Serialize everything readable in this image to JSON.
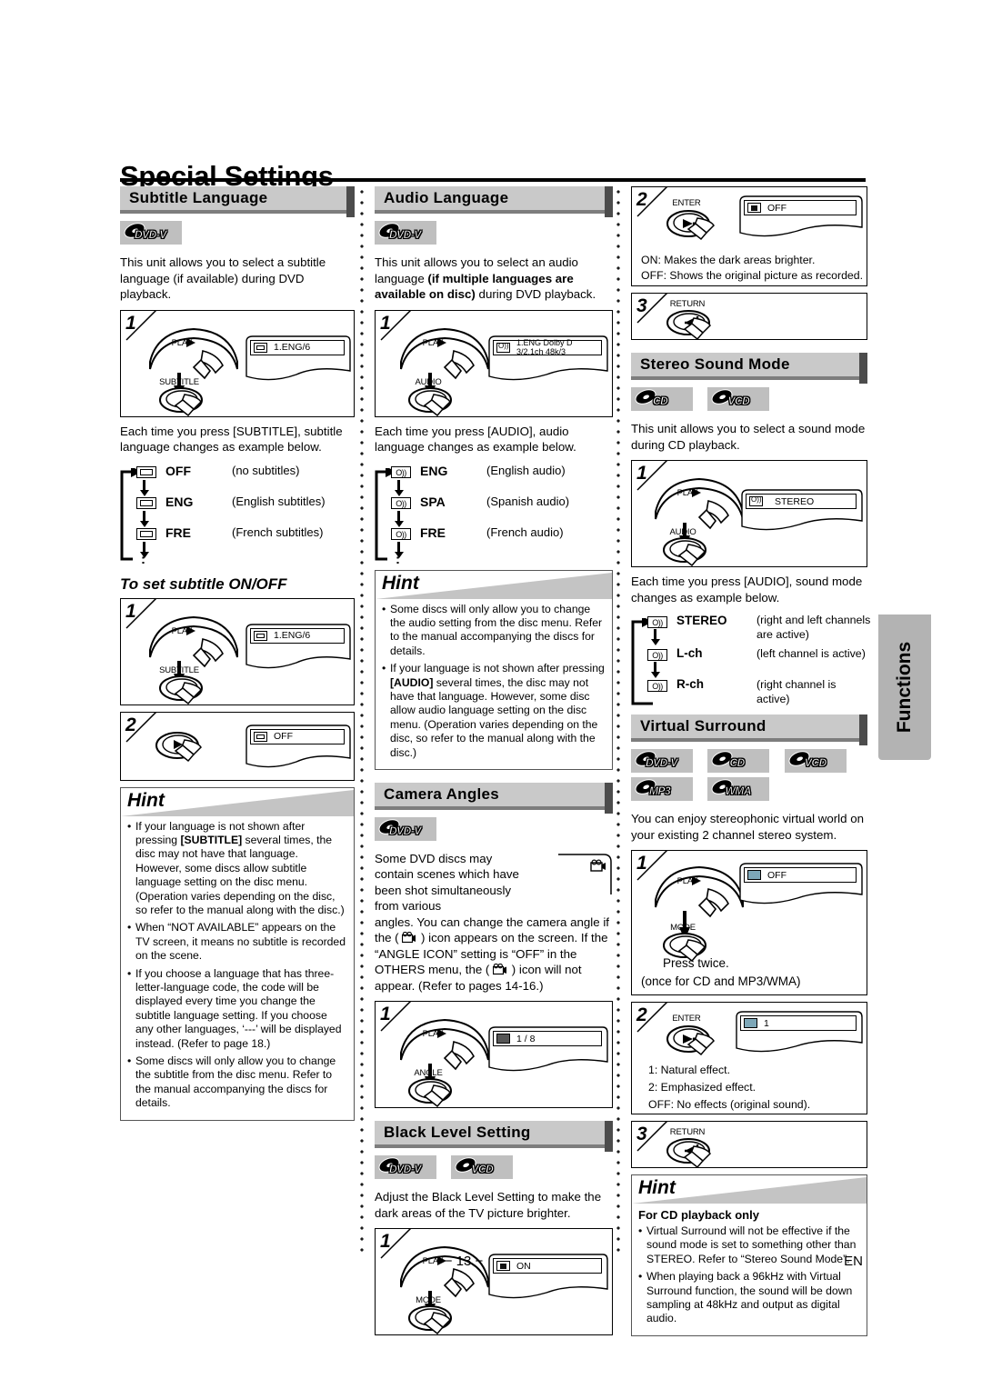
{
  "document": {
    "title": "Special Settings",
    "page_number": "− 13 −",
    "language_code": "EN",
    "side_tab": "Functions"
  },
  "column_left": {
    "subtitle_language": {
      "heading": "Subtitle Language",
      "badges": [
        "DVD-V"
      ],
      "intro": "This unit allows you to select a subtitle language (if available) during DVD playback.",
      "step1": {
        "number": "1",
        "btn_top": "PLAY",
        "btn_bottom": "SUBTITLE",
        "osd_value": "1.ENG/6"
      },
      "after_steps": "Each time you press [SUBTITLE], subtitle language changes as example below.",
      "sequence": [
        {
          "code": "OFF",
          "desc": "(no subtitles)"
        },
        {
          "code": "ENG",
          "desc": "(English subtitles)"
        },
        {
          "code": "FRE",
          "desc": "(French subtitles)"
        }
      ]
    },
    "on_off": {
      "heading": "To set subtitle ON/OFF",
      "step1": {
        "number": "1",
        "btn_top": "PLAY",
        "btn_bottom": "SUBTITLE",
        "osd_value": "1.ENG/6"
      },
      "step2": {
        "number": "2",
        "osd_value": "OFF"
      }
    },
    "hint": {
      "heading": "Hint",
      "items": [
        "If your language is not shown after pressing [SUBTITLE] several times, the disc may not have that language. However, some discs allow subtitle language setting on the disc menu. (Operation varies depending on the disc, so refer to the manual along with the disc.)",
        "When “NOT AVAILABLE” appears on the TV screen, it means no subtitle is recorded on the scene.",
        "If you choose a language that has three-letter-language code, the code will be displayed every time you change the subtitle language setting. If you choose any other languages, ‘---’ will be displayed instead. (Refer to page 18.)",
        "Some discs will only allow you to change the subtitle from the disc menu. Refer to the manual accompanying the discs for details."
      ]
    }
  },
  "column_middle": {
    "audio_language": {
      "heading": "Audio Language",
      "badges": [
        "DVD-V"
      ],
      "intro_a": "This unit allows you to select an audio language ",
      "intro_b": "(if multiple languages are available on disc)",
      "intro_c": " during DVD playback.",
      "step1": {
        "number": "1",
        "btn_top": "PLAY",
        "btn_bottom": "AUDIO",
        "osd_value": "1.ENG  Dolby D  3/2.1ch  48k/3"
      },
      "after_steps": "Each time you press [AUDIO], audio language changes as example below.",
      "sequence": [
        {
          "code": "ENG",
          "desc": "(English audio)"
        },
        {
          "code": "SPA",
          "desc": "(Spanish audio)"
        },
        {
          "code": "FRE",
          "desc": "(French audio)"
        }
      ]
    },
    "hint": {
      "heading": "Hint",
      "items": [
        "Some discs will only allow you to change the audio setting from the disc menu. Refer to the manual accompanying the discs for details.",
        "If your language is not shown after pressing [AUDIO] several times, the disc may not have that language. However, some disc allow audio language setting on the disc menu. (Operation varies depending on the disc, so refer to the manual along with the disc.)"
      ]
    },
    "camera_angles": {
      "heading": "Camera Angles",
      "badges": [
        "DVD-V"
      ],
      "intro": "Some DVD discs may contain scenes which have been shot simultaneously from various angles. You can change the camera angle if the (    ) icon appears on the screen. If the “ANGLE ICON” setting is “OFF” in the OTHERS menu, the (    ) icon will not appear. (Refer to pages 14-16.)",
      "step1": {
        "number": "1",
        "btn_top": "PLAY",
        "btn_bottom": "ANGLE",
        "osd_value": "1 / 8"
      }
    },
    "black_level": {
      "heading": "Black Level Setting",
      "badges": [
        "DVD-V",
        "VCD"
      ],
      "intro": "Adjust the Black Level Setting to make the dark areas of the TV picture brighter.",
      "step1": {
        "number": "1",
        "btn_top": "PLAY",
        "btn_bottom": "MODE",
        "osd_value": "ON"
      }
    }
  },
  "column_right": {
    "black_level_cont": {
      "step2": {
        "number": "2",
        "btn": "ENTER",
        "osd_value": "OFF",
        "note1": "ON: Makes the dark areas brighter.",
        "note2": "OFF: Shows the original picture as recorded."
      },
      "step3": {
        "number": "3",
        "btn": "RETURN"
      }
    },
    "stereo_sound_mode": {
      "heading": "Stereo Sound Mode",
      "badges": [
        "CD",
        "VCD"
      ],
      "intro": "This unit allows you to select a sound mode during CD playback.",
      "step1": {
        "number": "1",
        "btn_top": "PLAY",
        "btn_bottom": "AUDIO",
        "osd_value": "STEREO"
      },
      "after_steps": "Each time you press [AUDIO], sound mode changes as example below.",
      "sequence": [
        {
          "code": "STEREO",
          "desc": "(right and left channels are active)"
        },
        {
          "code": "L-ch",
          "desc": "(left channel is active)"
        },
        {
          "code": "R-ch",
          "desc": "(right channel is active)"
        }
      ]
    },
    "virtual_surround": {
      "heading": "Virtual Surround",
      "badges": [
        "DVD-V",
        "CD",
        "VCD",
        "MP3",
        "WMA"
      ],
      "intro": "You can enjoy stereophonic virtual world on your existing 2 channel stereo system.",
      "step1": {
        "number": "1",
        "btn_top": "PLAY",
        "btn_bottom": "MODE",
        "osd_value": "OFF",
        "note1": "Press twice.",
        "note2": "(once for CD and MP3/WMA)"
      },
      "step2": {
        "number": "2",
        "btn": "ENTER",
        "osd_value": "1",
        "note1": "1: Natural effect.",
        "note2": "2: Emphasized effect.",
        "note3": "OFF: No effects (original sound)."
      },
      "step3": {
        "number": "3",
        "btn": "RETURN"
      },
      "hint": {
        "heading": "Hint",
        "subheading": "For CD playback only",
        "items": [
          "Virtual Surround will not be effective if the sound mode is set to something other than STEREO. Refer to “Stereo Sound Mode”.",
          "When playing back a 96kHz with Virtual Surround function, the sound will be down sampling at 48kHz and output as digital audio."
        ]
      }
    }
  },
  "colors": {
    "header_bar": "#c9c9c9",
    "header_shadow": "#7d7d7d",
    "badge_bg": "#bfbfbf",
    "tab_bg": "#b3b3b3"
  }
}
